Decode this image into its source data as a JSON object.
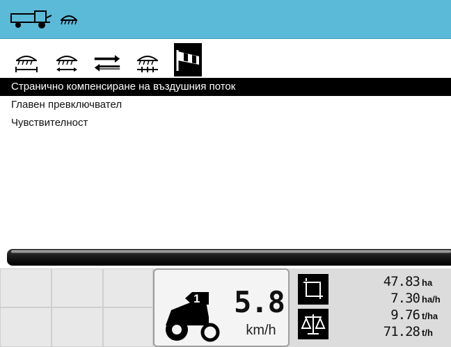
{
  "header": {
    "icons": [
      "combine-harvester-icon",
      "header-unit-icon"
    ]
  },
  "tabs": [
    {
      "icon": "header-width-icon",
      "active": false
    },
    {
      "icon": "header-lateral-icon",
      "active": false
    },
    {
      "icon": "swap-arrows-icon",
      "active": false
    },
    {
      "icon": "header-sections-icon",
      "active": false
    },
    {
      "icon": "windsock-icon",
      "active": true
    }
  ],
  "menu": {
    "items": [
      {
        "label": "Странично компенсиране на въздушния поток",
        "selected": true
      },
      {
        "label": "Главен превключвател",
        "selected": false
      },
      {
        "label": "Чувствителност",
        "selected": false
      }
    ]
  },
  "dashboard": {
    "gear": "1",
    "speed": {
      "value": "5.8",
      "unit": "km/h"
    },
    "stats": [
      {
        "value": "47.83",
        "unit": "ha"
      },
      {
        "value": "7.30",
        "unit": "ha/h"
      },
      {
        "value": "9.76",
        "unit": "t/ha"
      },
      {
        "value": "71.28",
        "unit": "t/h"
      }
    ]
  },
  "colors": {
    "titlebar": "#5bbad8",
    "selected_bg": "#000000",
    "selected_fg": "#ffffff",
    "windsock": "#ffffff"
  }
}
